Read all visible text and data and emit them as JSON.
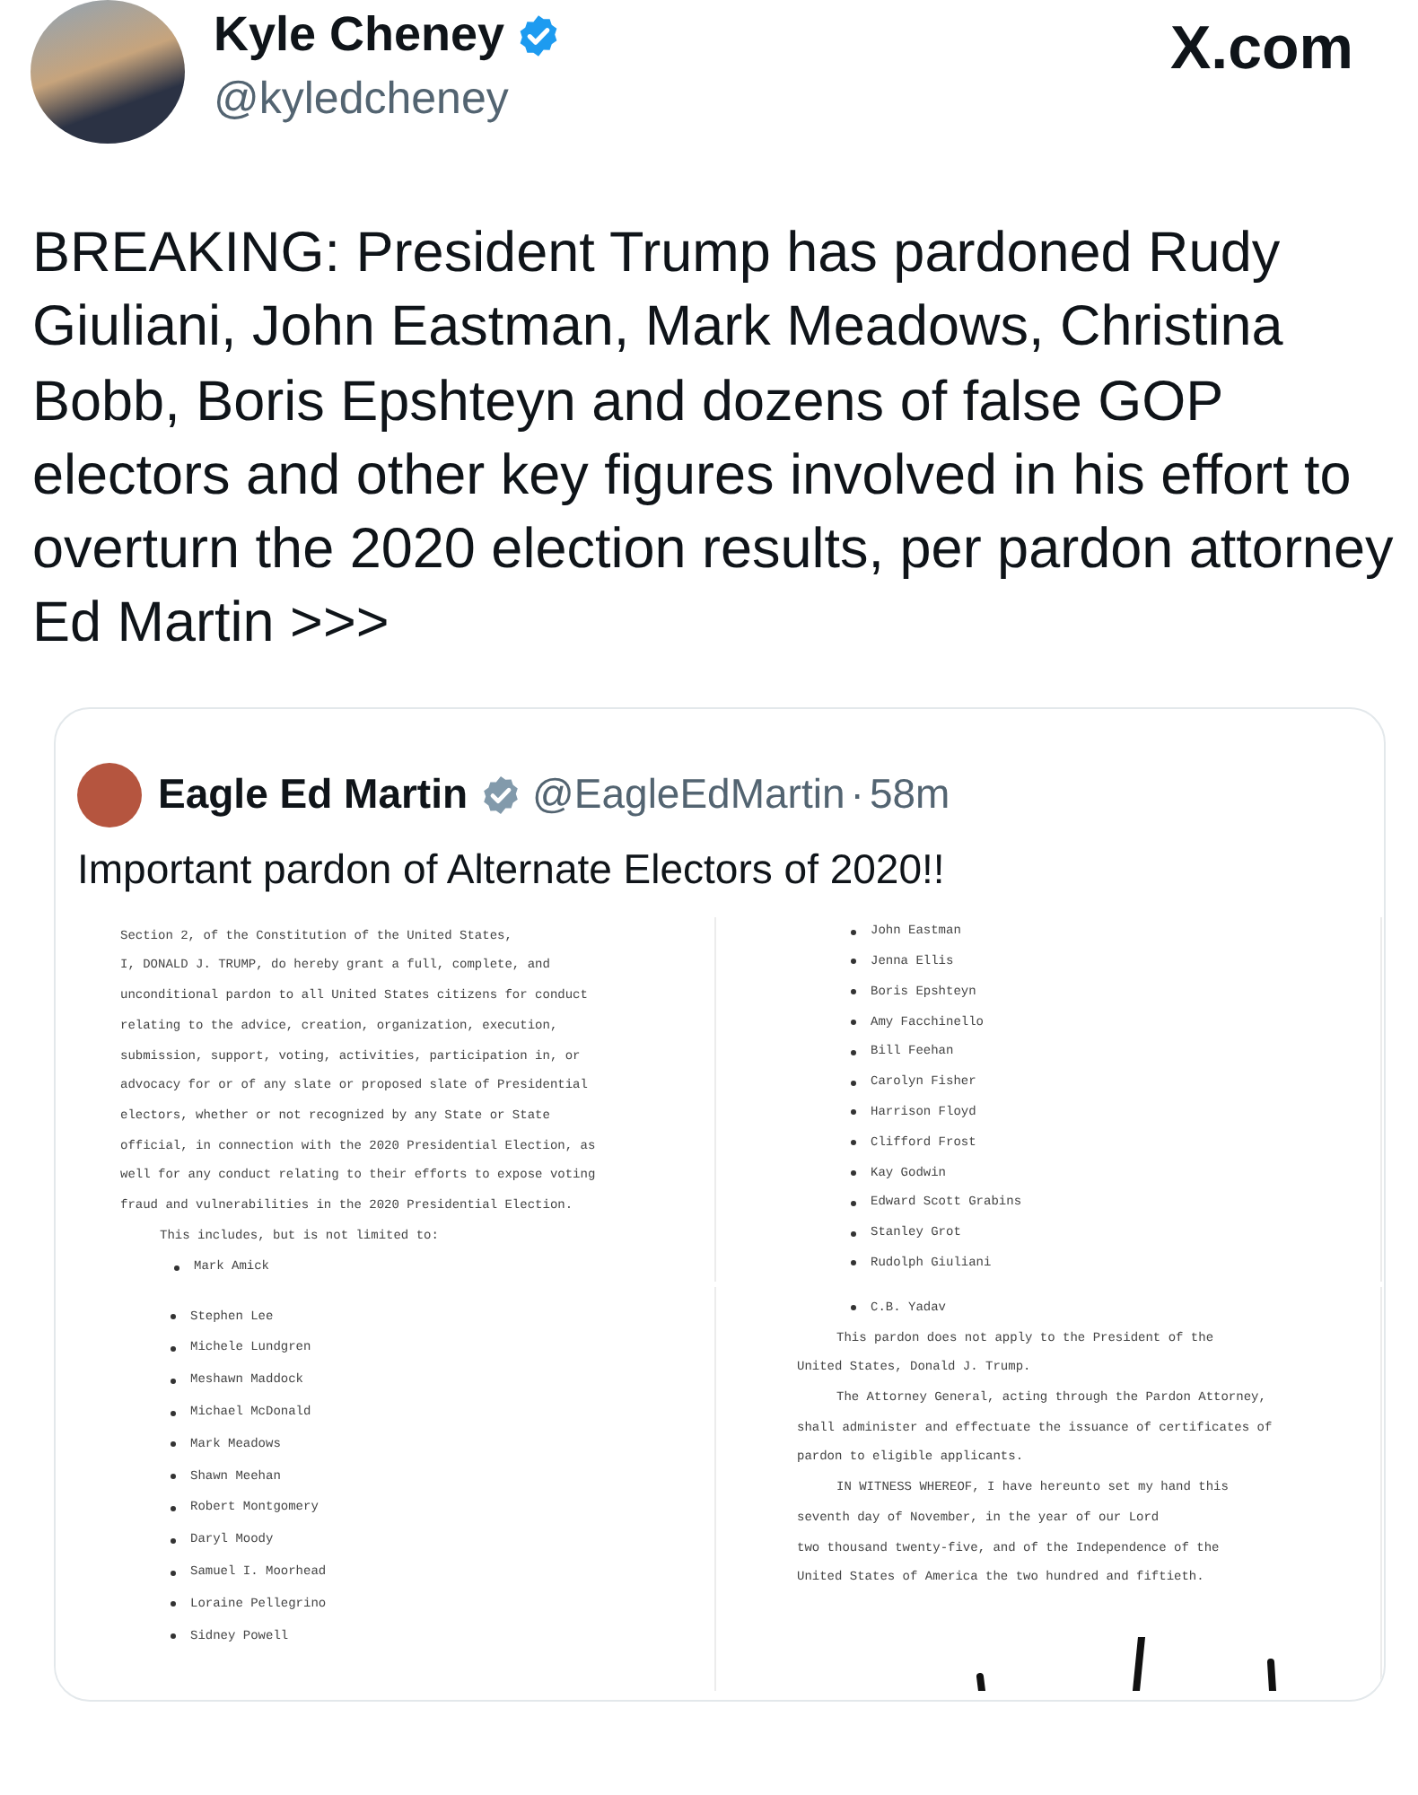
{
  "tweet": {
    "author": {
      "name": "Kyle Cheney",
      "handle": "@kyledcheney",
      "verified": true
    },
    "site": "X.com",
    "text": "BREAKING: President Trump has pardoned Rudy Giuliani, John Eastman, Mark Meadows, Christina Bobb, Boris Epshteyn and dozens of false GOP electors and other key figures involved in his effort to overturn the 2020 election results, per pardon attorney Ed Martin >>>"
  },
  "quote": {
    "author": {
      "name": "Eagle Ed Martin",
      "handle": "@EagleEdMartin",
      "verified": true
    },
    "separator": "·",
    "time": "58m",
    "text": "Important pardon of Alternate Electors of 2020!!",
    "document_pages": [
      {
        "lines": [
          {
            "kind": "line",
            "text": "Section 2, of the Constitution of the United States,"
          },
          {
            "kind": "line",
            "text": "I, DONALD J. TRUMP, do hereby grant a full, complete, and"
          },
          {
            "kind": "line",
            "text": "unconditional pardon to all United States citizens for conduct"
          },
          {
            "kind": "line",
            "text": "relating to the advice, creation, organization, execution,"
          },
          {
            "kind": "line",
            "text": "submission, support, voting, activities, participation in, or"
          },
          {
            "kind": "line",
            "text": "advocacy for or of any slate or proposed slate of Presidential"
          },
          {
            "kind": "line",
            "text": "electors, whether or not recognized by any State or State"
          },
          {
            "kind": "line",
            "text": "official, in connection with the 2020 Presidential Election, as"
          },
          {
            "kind": "line",
            "text": "well for any conduct relating to their efforts to expose voting"
          },
          {
            "kind": "line",
            "text": "fraud and vulnerabilities in the 2020 Presidential Election."
          },
          {
            "kind": "indent",
            "text": "This includes, but is not limited to:"
          },
          {
            "kind": "bullet",
            "text": "Mark Amick"
          }
        ]
      },
      {
        "lines": [
          {
            "kind": "bullet",
            "text": "John Eastman"
          },
          {
            "kind": "bullet",
            "text": "Jenna Ellis"
          },
          {
            "kind": "bullet",
            "text": "Boris Epshteyn"
          },
          {
            "kind": "bullet",
            "text": "Amy Facchinello"
          },
          {
            "kind": "bullet",
            "text": "Bill Feehan"
          },
          {
            "kind": "bullet",
            "text": "Carolyn Fisher"
          },
          {
            "kind": "bullet",
            "text": "Harrison Floyd"
          },
          {
            "kind": "bullet",
            "text": "Clifford Frost"
          },
          {
            "kind": "bullet",
            "text": "Kay Godwin"
          },
          {
            "kind": "bullet",
            "text": "Edward Scott Grabins"
          },
          {
            "kind": "bullet",
            "text": "Stanley Grot"
          },
          {
            "kind": "bullet",
            "text": "Rudolph Giuliani"
          }
        ]
      },
      {
        "lines": [
          {
            "kind": "bullet",
            "text": "Stephen Lee"
          },
          {
            "kind": "bullet",
            "text": "Michele Lundgren"
          },
          {
            "kind": "bullet",
            "text": "Meshawn Maddock"
          },
          {
            "kind": "bullet",
            "text": "Michael McDonald"
          },
          {
            "kind": "bullet",
            "text": "Mark Meadows"
          },
          {
            "kind": "bullet",
            "text": "Shawn Meehan"
          },
          {
            "kind": "bullet",
            "text": "Robert Montgomery"
          },
          {
            "kind": "bullet",
            "text": "Daryl Moody"
          },
          {
            "kind": "bullet",
            "text": "Samuel I. Moorhead"
          },
          {
            "kind": "bullet",
            "text": "Loraine Pellegrino"
          },
          {
            "kind": "bullet",
            "text": "Sidney Powell"
          }
        ]
      },
      {
        "signature": true,
        "lines": [
          {
            "kind": "bullet",
            "text": "C.B. Yadav"
          },
          {
            "kind": "indent",
            "text": "This pardon does not apply to the President of the"
          },
          {
            "kind": "line",
            "text": "United States, Donald J. Trump."
          },
          {
            "kind": "indent",
            "text": "The Attorney General, acting through the Pardon Attorney,"
          },
          {
            "kind": "line",
            "text": "shall administer and effectuate the issuance of certificates of"
          },
          {
            "kind": "line",
            "text": "pardon to eligible applicants."
          },
          {
            "kind": "indent",
            "text": "IN WITNESS WHEREOF, I have hereunto set my hand this"
          },
          {
            "kind": "line",
            "text": "seventh day of November, in the year of our Lord"
          },
          {
            "kind": "line",
            "text": "two thousand twenty-five, and of the Independence of the"
          },
          {
            "kind": "line",
            "text": "United States of America the two hundred and fiftieth."
          }
        ]
      }
    ]
  }
}
